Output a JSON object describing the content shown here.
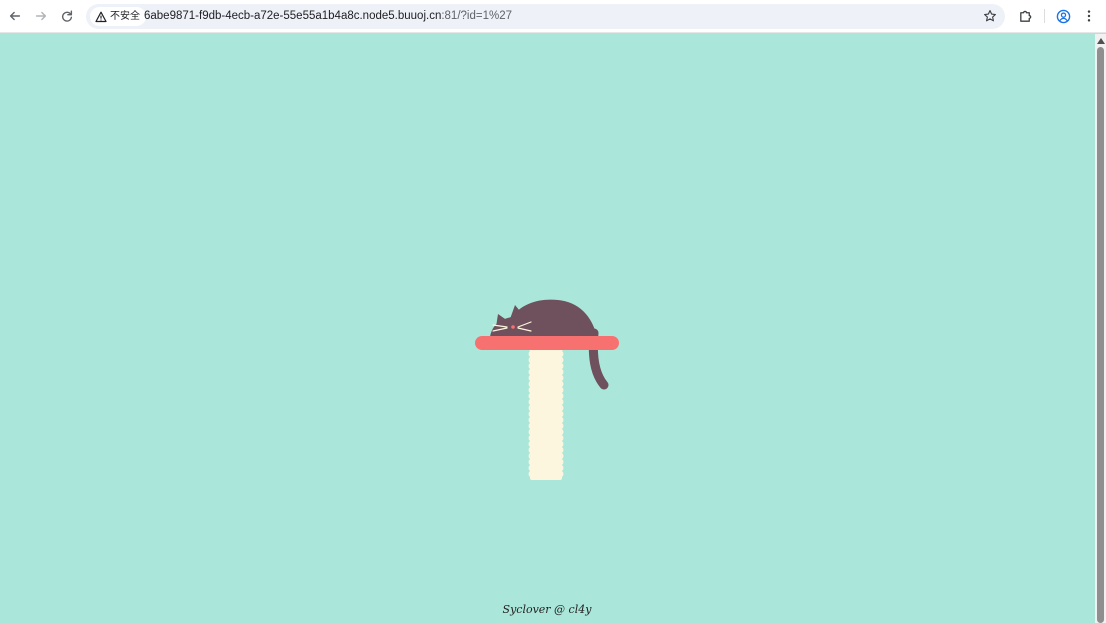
{
  "browser": {
    "security_label": "不安全",
    "url_host": "6abe9871-f9db-4ecb-a72e-55e55a1b4a8c.node5.buuoj.cn",
    "url_rest": ":81/?id=1%27",
    "icons": {
      "back": "arrow-left-icon",
      "forward": "arrow-right-icon",
      "reload": "reload-icon",
      "warning": "warning-triangle-icon",
      "bookmark": "star-icon",
      "extensions": "puzzle-icon",
      "profile": "profile-icon",
      "menu": "kebab-menu-icon"
    }
  },
  "page": {
    "background_color": "#abe6db",
    "footer_text": "Syclover @ cl4y"
  },
  "illustration": {
    "cat_color": "#6f505d",
    "shelf_color": "#f87171",
    "post_color": "#fdf6df"
  }
}
